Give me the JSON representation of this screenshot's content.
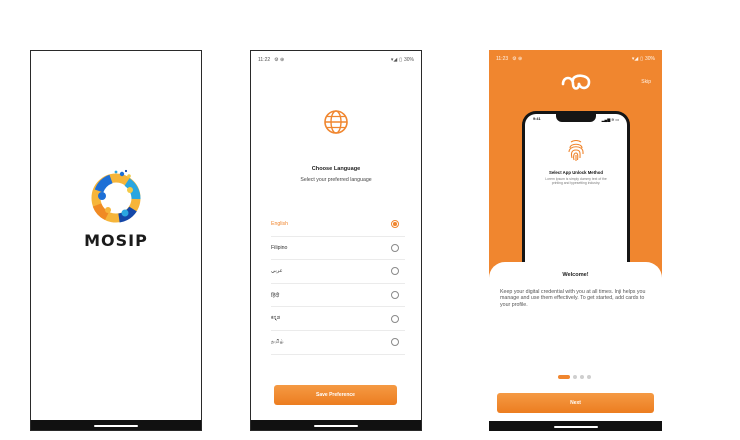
{
  "splash": {
    "brand_name": "MOSIP"
  },
  "language_screen": {
    "status": {
      "time": "11:22",
      "notif_icons": "⚙ ⊕",
      "battery": "30%"
    },
    "title": "Choose Language",
    "subtitle": "Select your preferred language",
    "languages": [
      {
        "label": "English",
        "selected": true
      },
      {
        "label": "Filipino",
        "selected": false
      },
      {
        "label": "عربي",
        "selected": false
      },
      {
        "label": "हिंदी",
        "selected": false
      },
      {
        "label": "ಕನ್ನಡ",
        "selected": false
      },
      {
        "label": "தமிழ்",
        "selected": false
      }
    ],
    "save_label": "Save Preference"
  },
  "onboarding_screen": {
    "status": {
      "time": "11:23",
      "notif_icons": "⚙ ⊕",
      "battery": "30%"
    },
    "skip_label": "Skip",
    "mock_phone": {
      "time": "9:41",
      "status_icons": "▂▄▆ ≋ ▭",
      "title": "Select App Unlock Method",
      "description": "Lorem Ipsum is simply dummy text of the printing and typesetting industry."
    },
    "welcome_title": "Welcome!",
    "welcome_text": "Keep your digital credential with you at all times. Inji helps you manage and use them effectively. To get started, add cards to your profile.",
    "pagination": {
      "pages": 4,
      "active": 1
    },
    "next_label": "Next"
  },
  "colors": {
    "accent": "#f0862f",
    "accent_dark": "#ec7d20",
    "nav_bar": "#111111"
  }
}
